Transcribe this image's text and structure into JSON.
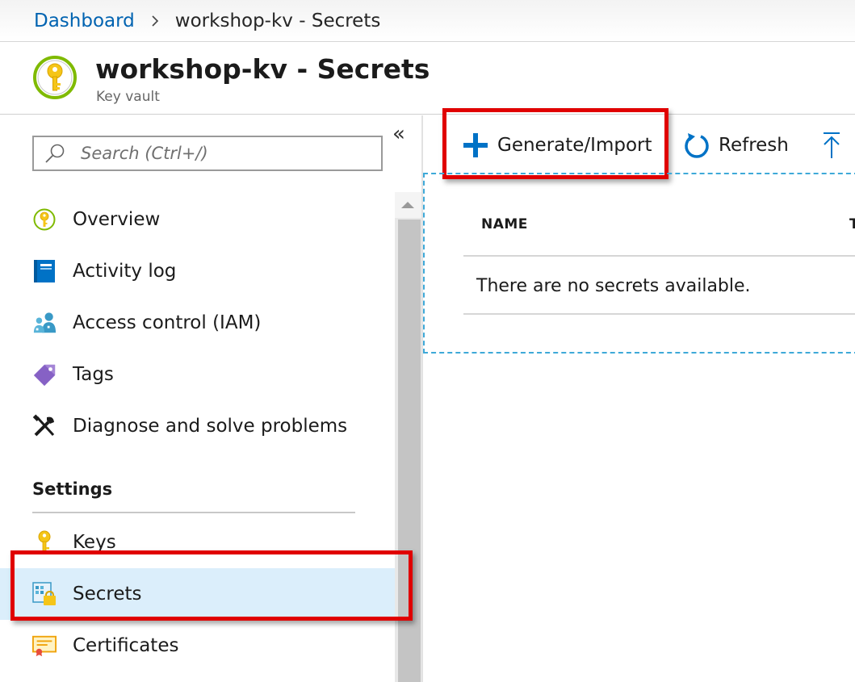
{
  "breadcrumb": {
    "link": "Dashboard",
    "current": "workshop-kv - Secrets"
  },
  "header": {
    "title": "workshop-kv - Secrets",
    "subtitle": "Key vault",
    "icon": "key-vault-icon"
  },
  "sidebar": {
    "search_placeholder": "Search (Ctrl+/)",
    "collapse_label": "«",
    "items": [
      {
        "label": "Overview",
        "icon": "key-vault-icon"
      },
      {
        "label": "Activity log",
        "icon": "activity-log-icon"
      },
      {
        "label": "Access control (IAM)",
        "icon": "people-icon"
      },
      {
        "label": "Tags",
        "icon": "tag-icon"
      },
      {
        "label": "Diagnose and solve problems",
        "icon": "tools-icon"
      }
    ],
    "section_title": "Settings",
    "settings_items": [
      {
        "label": "Keys",
        "icon": "key-icon"
      },
      {
        "label": "Secrets",
        "icon": "secret-icon",
        "selected": true
      },
      {
        "label": "Certificates",
        "icon": "certificate-icon"
      }
    ]
  },
  "toolbar": {
    "generate_label": "Generate/Import",
    "refresh_label": "Refresh"
  },
  "grid": {
    "columns": [
      "NAME",
      "T"
    ],
    "empty_message": "There are no secrets available."
  },
  "colors": {
    "accent": "#0063b1",
    "highlight_box": "#e00000",
    "selected_bg": "#dbeefb",
    "dashed_border": "#3ea9d8"
  }
}
